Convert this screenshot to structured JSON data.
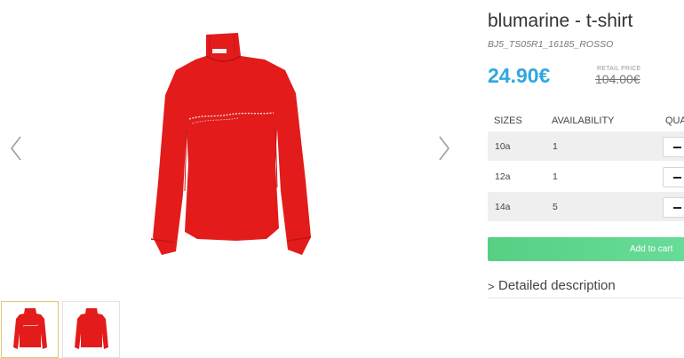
{
  "product": {
    "title": "blumarine - t-shirt",
    "sku": "BJ5_TS05R1_16185_ROSSO",
    "price": "24.90€",
    "retail_label": "RETAIL PRICE",
    "retail_price": "104.00€",
    "color": "#e31b1b"
  },
  "sizes_table": {
    "headers": [
      "SIZES",
      "AVAILABILITY",
      "QUA"
    ],
    "rows": [
      {
        "size": "10a",
        "availability": "1"
      },
      {
        "size": "12a",
        "availability": "1"
      },
      {
        "size": "14a",
        "availability": "5"
      }
    ]
  },
  "actions": {
    "add_to_cart": "Add to cart",
    "detailed_description": "Detailed description"
  },
  "gallery": {
    "prev_icon": "chevron-left-icon",
    "next_icon": "chevron-right-icon",
    "thumbnail_count": 2,
    "active_thumbnail": 1
  },
  "colors": {
    "price": "#2ea7df",
    "cart_button": "#5fd68e",
    "thumb_active_border": "#e8c37a"
  }
}
